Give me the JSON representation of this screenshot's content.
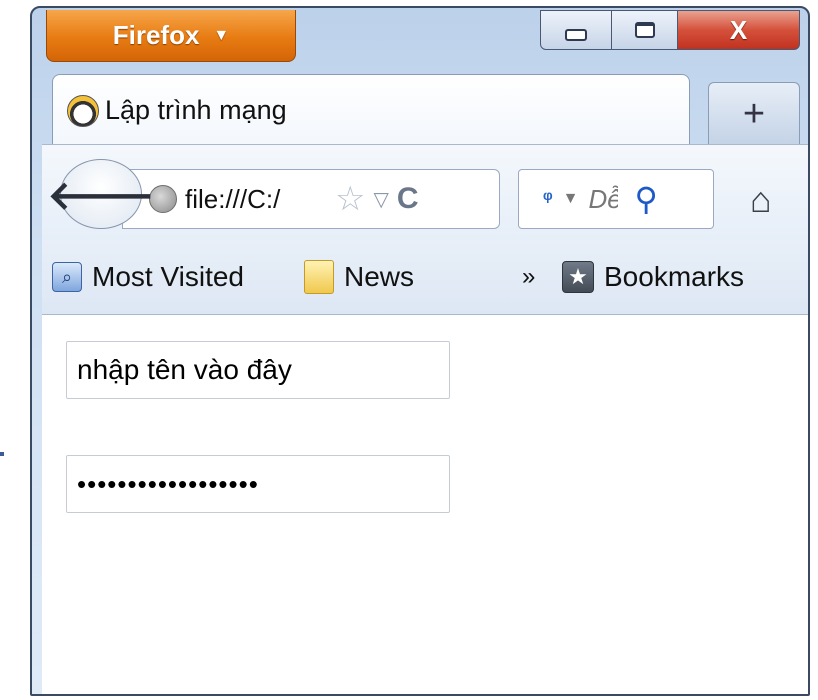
{
  "app_button": {
    "label": "Firefox",
    "caret": "▼"
  },
  "window_controls": {
    "close_label": "X"
  },
  "tab": {
    "title": "Lập trình mạng"
  },
  "new_tab": {
    "label": "+"
  },
  "toolbar": {
    "back_glyph": "🡐",
    "url": "file:///C:/",
    "star_glyph": "☆",
    "dropdown_glyph": "▽",
    "reload_glyph": "C",
    "search_placeholder": "Dễ",
    "search_glyph": "⚲",
    "home_glyph": "⌂"
  },
  "bookmarks": {
    "items": [
      {
        "label": "Most Visited",
        "icon": "most-visited-icon"
      },
      {
        "label": "News",
        "icon": "folder-icon"
      }
    ],
    "chevron": "»",
    "menu_label": "Bookmarks"
  },
  "form": {
    "name_value": "nhập tên vào đây",
    "password_value": "••••••••••••••••••"
  }
}
